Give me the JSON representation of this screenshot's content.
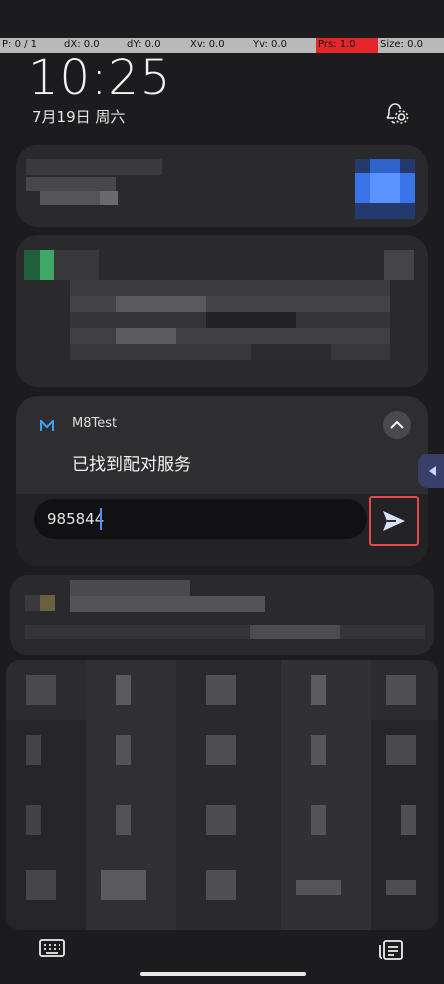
{
  "debug_bar": {
    "p": "P: 0 / 1",
    "dx": "dX: 0.0",
    "dy": "dY: 0.0",
    "xv": "Xv: 0.0",
    "yv": "Yv: 0.0",
    "prs": "Prs: 1.0",
    "size": "Size: 0.0",
    "prs_color": "#e6262b"
  },
  "lockscreen": {
    "time": "10:25",
    "date": "7月19日 周六"
  },
  "notification": {
    "app_name": "M8Test",
    "title": "已找到配对服务",
    "reply_value": "985844",
    "send_highlight_color": "#e5474a"
  },
  "icons": {
    "notification_settings": "bell-gear-icon",
    "collapse": "chevron-up-icon",
    "send": "send-icon",
    "keyboard": "keyboard-icon",
    "notification_list": "notification-list-icon"
  }
}
